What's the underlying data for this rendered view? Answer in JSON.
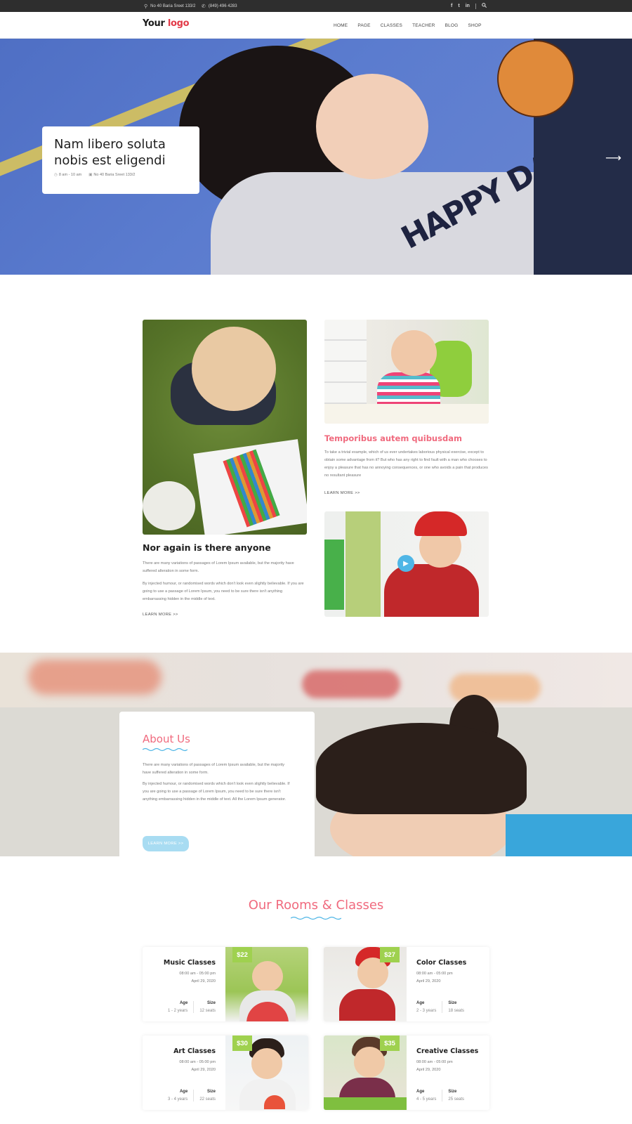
{
  "topbar": {
    "address": "No 40 Baria Sreet 133/2",
    "phone": "(849) 496 4283",
    "social": [
      "f",
      "t",
      "in"
    ],
    "search_icon": "search-icon"
  },
  "header": {
    "logo_part1": "Your",
    "logo_part2": "logo",
    "nav": [
      "HOME",
      "PAGE",
      "CLASSES",
      "TEACHER",
      "BLOG",
      "SHOP"
    ]
  },
  "hero": {
    "title": "Nam libero soluta nobis est eligendi",
    "time": "8 am - 10 am",
    "location": "No 40 Baria Sreet 133/2",
    "shirt_text": "HAPPY DAY"
  },
  "features": {
    "left": {
      "title": "Nor again is there anyone",
      "p1": "There are many variations of passages of Lorem Ipsum available, but the majority have suffered alteration in some form.",
      "p2": "By injected humour, or randomised words which don't look even slightly believable. If you are going to use a passage of Lorem Ipsum, you need to be sure there isn't anything embarrassing hidden in the middle of text.",
      "link": "LEARN MORE  >>"
    },
    "right": {
      "title": "Temporibus autem quibusdam",
      "p1": "To take a trivial example, which of us ever undertakes laborious physical exercise, except to obtain some advantage from it? But who has any right to find fault with a man who chooses to enjoy a pleasure that has no annoying consequences, or one who avoids a pain that produces no resultant pleasure",
      "link": "LEARN MORE  >>"
    }
  },
  "about": {
    "title": "About Us",
    "p1": "There are many variations of passages of Lorem Ipsum available, but the majority have suffered alteration in some form.",
    "p2": "By injected humour, or randomised words which don't look even slightly believable. If you are going to use a passage of Lorem Ipsum, you need to be sure there isn't anything embarrassing hidden in the middle of text. All the Lorem Ipsum generator.",
    "button": "LEARN MORE  >>"
  },
  "rooms": {
    "title": "Our Rooms & Classes",
    "age_label": "Age",
    "size_label": "Size",
    "classes": [
      {
        "name": "Music Classes",
        "time": "08:00 am - 05:00 pm",
        "date": "April 29, 2020",
        "age": "1 - 2 years",
        "size": "12 seats",
        "price": "$22"
      },
      {
        "name": "Color Classes",
        "time": "08:00 am - 05:00 pm",
        "date": "April 29, 2020",
        "age": "2 - 3 years",
        "size": "18 seats",
        "price": "$27"
      },
      {
        "name": "Art Classes",
        "time": "08:00 am - 05:00 pm",
        "date": "April 29, 2020",
        "age": "3 - 4 years",
        "size": "22 seats",
        "price": "$30"
      },
      {
        "name": "Creative Classes",
        "time": "08:00 am - 05:00 pm",
        "date": "April 29, 2020",
        "age": "4 - 5 years",
        "size": "25 seats",
        "price": "$35"
      }
    ]
  },
  "colors": {
    "accent_pink": "#f06a7e",
    "price_green": "#9fd14f",
    "button_blue": "#a8dcf2",
    "logo_red": "#e23a48"
  }
}
